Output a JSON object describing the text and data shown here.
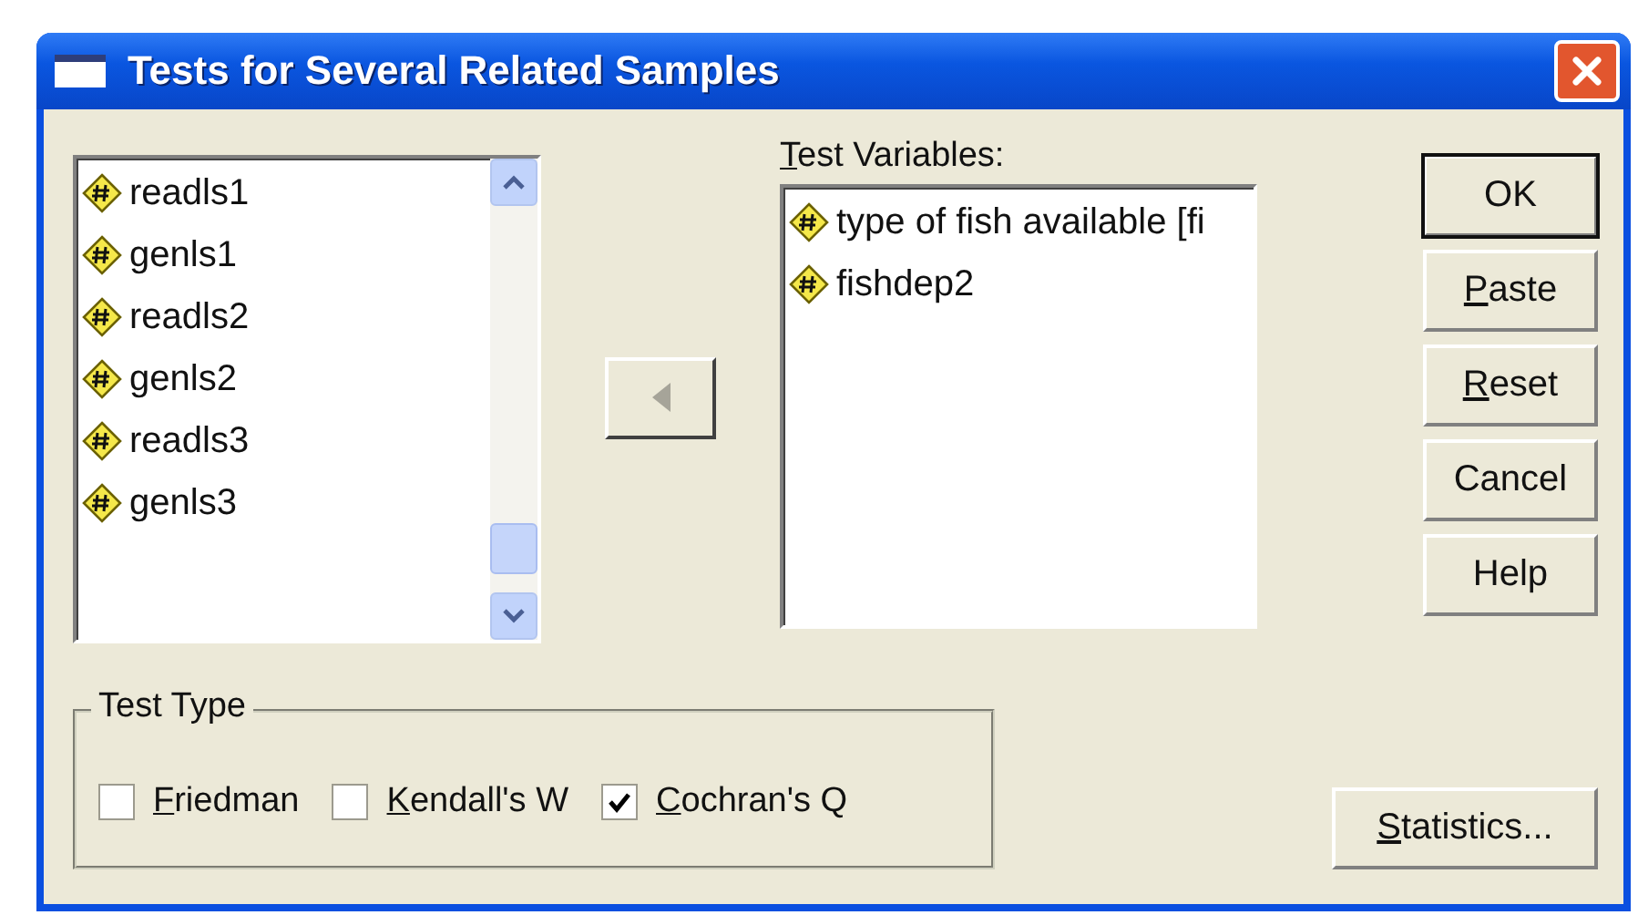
{
  "window": {
    "title": "Tests for Several Related Samples"
  },
  "source_list": {
    "items": [
      {
        "label": "readls1",
        "selected": false
      },
      {
        "label": "genls1",
        "selected": false
      },
      {
        "label": "readls2",
        "selected": false
      },
      {
        "label": "genls2",
        "selected": false
      },
      {
        "label": "readls3",
        "selected": false
      },
      {
        "label": "genls3",
        "selected": false
      }
    ]
  },
  "move_button": {
    "disabled": true
  },
  "test_variables": {
    "label": "Test Variables:",
    "underline_first": true,
    "items": [
      {
        "label": "type of fish available [fi",
        "selected": false
      },
      {
        "label": "fishdep2",
        "selected": false
      }
    ]
  },
  "buttons": [
    {
      "label": "OK",
      "default": true,
      "underline_first": false
    },
    {
      "label": "Paste",
      "default": false,
      "underline_first": true
    },
    {
      "label": "Reset",
      "default": false,
      "underline_first": true
    },
    {
      "label": "Cancel",
      "default": false,
      "underline_first": false
    },
    {
      "label": "Help",
      "default": false,
      "underline_first": false
    }
  ],
  "test_type": {
    "title": "Test Type",
    "options": [
      {
        "label": "Friedman",
        "checked": false,
        "underline_first": true
      },
      {
        "label": "Kendall's W",
        "checked": false,
        "underline_first": true
      },
      {
        "label": "Cochran's Q",
        "checked": true,
        "underline_first": true
      }
    ]
  },
  "statistics_button": {
    "label": "Statistics...",
    "underline_first": true
  }
}
